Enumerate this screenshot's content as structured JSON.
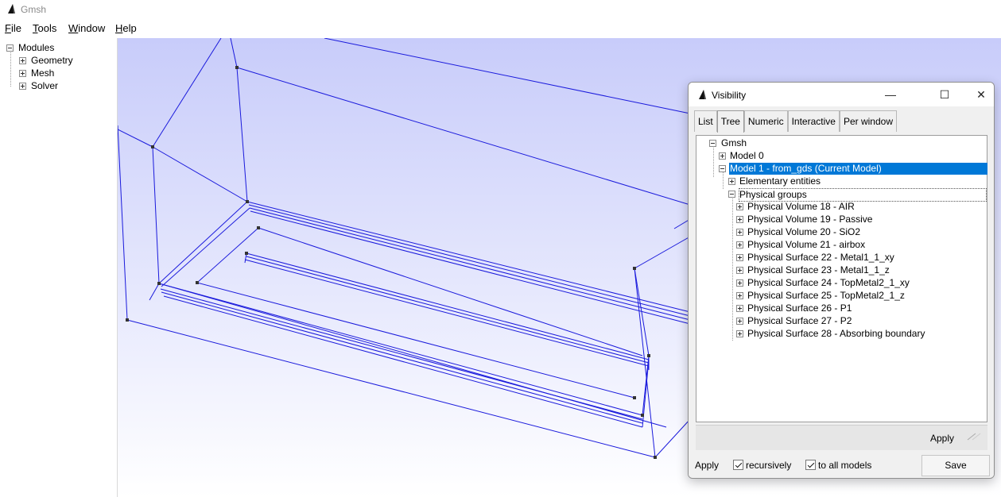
{
  "window": {
    "title": "Gmsh"
  },
  "menu": [
    {
      "label": "File",
      "key": "F",
      "rest": "ile"
    },
    {
      "label": "Tools",
      "key": "T",
      "rest": "ools"
    },
    {
      "label": "Window",
      "key": "W",
      "rest": "indow"
    },
    {
      "label": "Help",
      "key": "H",
      "rest": "elp"
    }
  ],
  "left_tree": {
    "root": "Modules",
    "items": [
      "Geometry",
      "Mesh",
      "Solver"
    ]
  },
  "dialog": {
    "title": "Visibility",
    "tabs": [
      "List",
      "Tree",
      "Numeric",
      "Interactive",
      "Per window"
    ],
    "active_tab": "Tree",
    "tree": {
      "root": "Gmsh",
      "model0": "Model 0",
      "model1": "Model 1 - from_gds (Current Model)",
      "elementary": "Elementary entities",
      "physical": "Physical groups",
      "groups": [
        "Physical Volume 18 - AIR",
        "Physical Volume 19 - Passive",
        "Physical Volume 20 - SiO2",
        "Physical Volume 21 - airbox",
        "Physical Surface 22 - Metal1_1_xy",
        "Physical Surface 23 - Metal1_1_z",
        "Physical Surface 24 - TopMetal2_1_xy",
        "Physical Surface 25 - TopMetal2_1_z",
        "Physical Surface 26 - P1",
        "Physical Surface 27 - P2",
        "Physical Surface 28 - Absorbing boundary"
      ]
    },
    "apply_button": "Apply",
    "footer": {
      "apply_label": "Apply",
      "recursively_label": "recursively",
      "recursively_checked": true,
      "all_models_label": "to all models",
      "all_models_checked": true,
      "save_button": "Save"
    },
    "window_buttons": {
      "minimize": "—",
      "maximize": "☐",
      "close": "✕"
    }
  },
  "colors": {
    "selection": "#0078d7",
    "mesh_lines": "#1a1adc",
    "viewport_top": "#c8ccfa"
  }
}
